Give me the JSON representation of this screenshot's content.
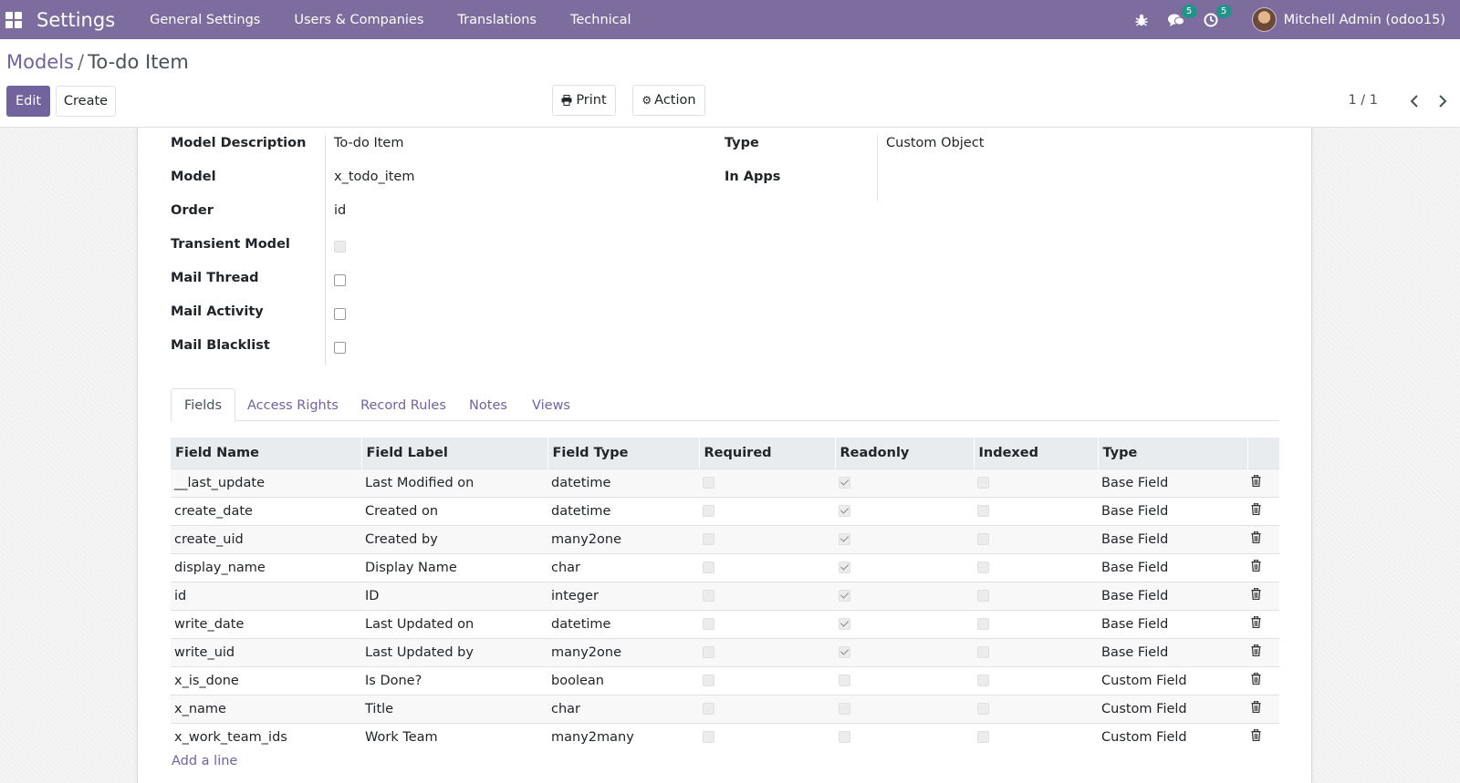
{
  "navbar": {
    "app_title": "Settings",
    "menu": [
      "General Settings",
      "Users & Companies",
      "Translations",
      "Technical"
    ],
    "messages_badge": "5",
    "activities_badge": "5",
    "user": "Mitchell Admin (odoo15)"
  },
  "breadcrumb": {
    "parent": "Models",
    "separator": "/",
    "current": "To-do Item"
  },
  "toolbar": {
    "edit": "Edit",
    "create": "Create",
    "print": "Print",
    "action": "Action",
    "pager": "1 / 1"
  },
  "form": {
    "model_description_label": "Model Description",
    "model_description": "To-do Item",
    "model_label": "Model",
    "model": "x_todo_item",
    "order_label": "Order",
    "order": "id",
    "transient_label": "Transient Model",
    "transient": false,
    "mail_thread_label": "Mail Thread",
    "mail_thread": false,
    "mail_activity_label": "Mail Activity",
    "mail_activity": false,
    "mail_blacklist_label": "Mail Blacklist",
    "mail_blacklist": false,
    "type_label": "Type",
    "type": "Custom Object",
    "in_apps_label": "In Apps",
    "in_apps": ""
  },
  "tabs": [
    "Fields",
    "Access Rights",
    "Record Rules",
    "Notes",
    "Views"
  ],
  "fields_table": {
    "columns": [
      "Field Name",
      "Field Label",
      "Field Type",
      "Required",
      "Readonly",
      "Indexed",
      "Type"
    ],
    "rows": [
      {
        "name": "__last_update",
        "label": "Last Modified on",
        "ftype": "datetime",
        "required": false,
        "readonly": true,
        "indexed": false,
        "type": "Base Field"
      },
      {
        "name": "create_date",
        "label": "Created on",
        "ftype": "datetime",
        "required": false,
        "readonly": true,
        "indexed": false,
        "type": "Base Field"
      },
      {
        "name": "create_uid",
        "label": "Created by",
        "ftype": "many2one",
        "required": false,
        "readonly": true,
        "indexed": false,
        "type": "Base Field"
      },
      {
        "name": "display_name",
        "label": "Display Name",
        "ftype": "char",
        "required": false,
        "readonly": true,
        "indexed": false,
        "type": "Base Field"
      },
      {
        "name": "id",
        "label": "ID",
        "ftype": "integer",
        "required": false,
        "readonly": true,
        "indexed": false,
        "type": "Base Field"
      },
      {
        "name": "write_date",
        "label": "Last Updated on",
        "ftype": "datetime",
        "required": false,
        "readonly": true,
        "indexed": false,
        "type": "Base Field"
      },
      {
        "name": "write_uid",
        "label": "Last Updated by",
        "ftype": "many2one",
        "required": false,
        "readonly": true,
        "indexed": false,
        "type": "Base Field"
      },
      {
        "name": "x_is_done",
        "label": "Is Done?",
        "ftype": "boolean",
        "required": false,
        "readonly": false,
        "indexed": false,
        "type": "Custom Field"
      },
      {
        "name": "x_name",
        "label": "Title",
        "ftype": "char",
        "required": false,
        "readonly": false,
        "indexed": false,
        "type": "Custom Field"
      },
      {
        "name": "x_work_team_ids",
        "label": "Work Team",
        "ftype": "many2many",
        "required": false,
        "readonly": false,
        "indexed": false,
        "type": "Custom Field"
      }
    ],
    "add_line": "Add a line"
  }
}
